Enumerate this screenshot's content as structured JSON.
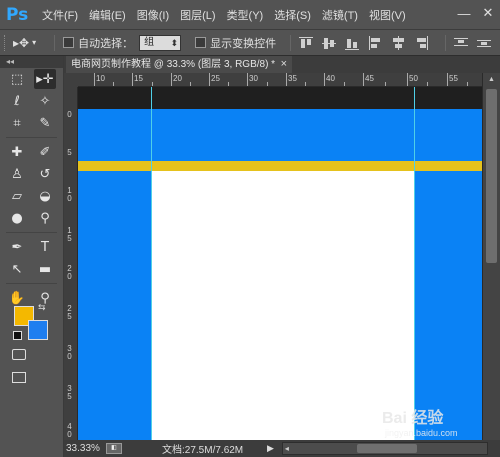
{
  "app": {
    "logo": "Ps"
  },
  "menu": [
    "文件(F)",
    "编辑(E)",
    "图像(I)",
    "图层(L)",
    "类型(Y)",
    "选择(S)",
    "滤镜(T)",
    "视图(V)"
  ],
  "window_controls": {
    "minimize": "—",
    "close": "✕"
  },
  "options_bar": {
    "auto_select_label": "自动选择：",
    "auto_select_value": "组",
    "show_transform_label": "显示变换控件"
  },
  "document": {
    "tab_title": "电商网页制作教程 @ 33.3% (图层 3, RGB/8) *",
    "tab_close": "×"
  },
  "ruler_top_labels": [
    "10",
    "15",
    "20",
    "25",
    "30",
    "35",
    "40",
    "45",
    "50",
    "55"
  ],
  "ruler_left_labels": [
    "0",
    "5",
    "1\n0",
    "1\n5",
    "2\n0",
    "2\n5",
    "3\n0",
    "3\n5",
    "4\n0"
  ],
  "canvas": {
    "background_color": "#0a82f5",
    "band_color": "#e6c21c",
    "content_color": "#ffffff",
    "guide_color": "#4fd0e8"
  },
  "colors": {
    "foreground": "#f4b800",
    "background": "#1e7ef0"
  },
  "status": {
    "zoom": "33.33%",
    "doc_size": "文档:27.5M/7.62M"
  },
  "watermark": {
    "main": "Bai 经验",
    "sub": "jingyan.baidu.com"
  }
}
